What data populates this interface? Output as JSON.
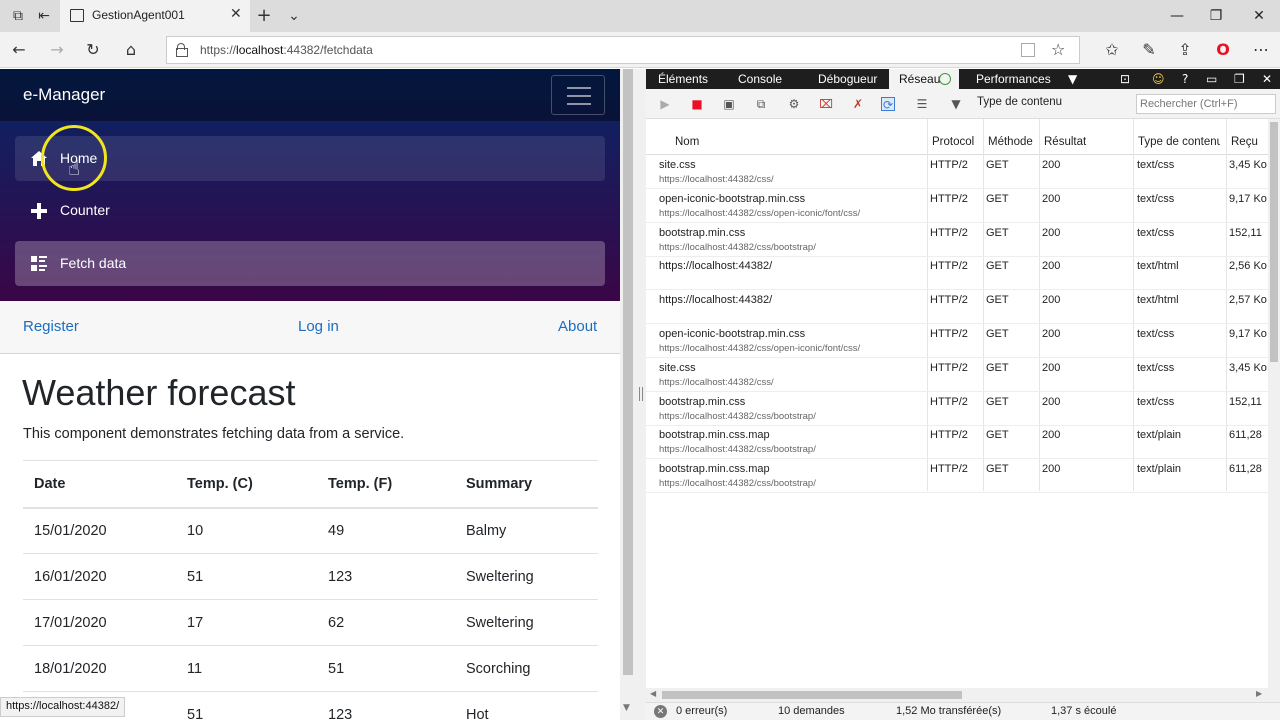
{
  "browser": {
    "tab_title": "GestionAgent001",
    "url_prefix": "https://",
    "url_host": "localhost",
    "url_rest": ":44382/fetchdata",
    "status_tooltip": "https://localhost:44382/"
  },
  "app": {
    "brand": "e-Manager",
    "nav": {
      "home": "Home",
      "counter": "Counter",
      "fetch_data": "Fetch data"
    },
    "top_links": {
      "register": "Register",
      "login": "Log in",
      "about": "About"
    },
    "page_title": "Weather forecast",
    "page_description": "This component demonstrates fetching data from a service.",
    "table": {
      "headers": [
        "Date",
        "Temp. (C)",
        "Temp. (F)",
        "Summary"
      ],
      "rows": [
        [
          "15/01/2020",
          "10",
          "49",
          "Balmy"
        ],
        [
          "16/01/2020",
          "51",
          "123",
          "Sweltering"
        ],
        [
          "17/01/2020",
          "17",
          "62",
          "Sweltering"
        ],
        [
          "18/01/2020",
          "11",
          "51",
          "Scorching"
        ],
        [
          "",
          "51",
          "123",
          "Hot"
        ]
      ]
    }
  },
  "devtools": {
    "tabs": {
      "elements": "Éléments",
      "console": "Console",
      "debugger": "Débogueur",
      "network": "Réseau",
      "performance": "Performances"
    },
    "filter_label": "Type de contenu",
    "search_placeholder": "Rechercher (Ctrl+F)",
    "columns": {
      "name": "Nom",
      "protocol": "Protocol",
      "method": "Méthode",
      "result": "Résultat",
      "content_type": "Type de contenu",
      "received": "Reçu"
    },
    "requests": [
      {
        "name": "site.css",
        "path": "https://localhost:44382/css/",
        "protocol": "HTTP/2",
        "method": "GET",
        "result": "200",
        "type": "text/css",
        "received": "3,45 Ko"
      },
      {
        "name": "open-iconic-bootstrap.min.css",
        "path": "https://localhost:44382/css/open-iconic/font/css/",
        "protocol": "HTTP/2",
        "method": "GET",
        "result": "200",
        "type": "text/css",
        "received": "9,17 Ko"
      },
      {
        "name": "bootstrap.min.css",
        "path": "https://localhost:44382/css/bootstrap/",
        "protocol": "HTTP/2",
        "method": "GET",
        "result": "200",
        "type": "text/css",
        "received": "152,11"
      },
      {
        "name": "https://localhost:44382/",
        "path": "",
        "protocol": "HTTP/2",
        "method": "GET",
        "result": "200",
        "type": "text/html",
        "received": "2,56 Ko"
      },
      {
        "name": "https://localhost:44382/",
        "path": "",
        "protocol": "HTTP/2",
        "method": "GET",
        "result": "200",
        "type": "text/html",
        "received": "2,57 Ko"
      },
      {
        "name": "open-iconic-bootstrap.min.css",
        "path": "https://localhost:44382/css/open-iconic/font/css/",
        "protocol": "HTTP/2",
        "method": "GET",
        "result": "200",
        "type": "text/css",
        "received": "9,17 Ko"
      },
      {
        "name": "site.css",
        "path": "https://localhost:44382/css/",
        "protocol": "HTTP/2",
        "method": "GET",
        "result": "200",
        "type": "text/css",
        "received": "3,45 Ko"
      },
      {
        "name": "bootstrap.min.css",
        "path": "https://localhost:44382/css/bootstrap/",
        "protocol": "HTTP/2",
        "method": "GET",
        "result": "200",
        "type": "text/css",
        "received": "152,11"
      },
      {
        "name": "bootstrap.min.css.map",
        "path": "https://localhost:44382/css/bootstrap/",
        "protocol": "HTTP/2",
        "method": "GET",
        "result": "200",
        "type": "text/plain",
        "received": "611,28"
      },
      {
        "name": "bootstrap.min.css.map",
        "path": "https://localhost:44382/css/bootstrap/",
        "protocol": "HTTP/2",
        "method": "GET",
        "result": "200",
        "type": "text/plain",
        "received": "611,28"
      }
    ],
    "status": {
      "errors": "0 erreur(s)",
      "requests": "10 demandes",
      "transferred": "1,52 Mo transférée(s)",
      "elapsed": "1,37 s écoulé"
    }
  },
  "colors": {
    "sidebar_top": "#052767",
    "sidebar_bottom": "#3a0647",
    "link_blue": "#1b6ec2",
    "cursor_highlight": "#f0e51e",
    "devtools_tabbar": "#1e1e1e",
    "record_red": "#e81123"
  }
}
